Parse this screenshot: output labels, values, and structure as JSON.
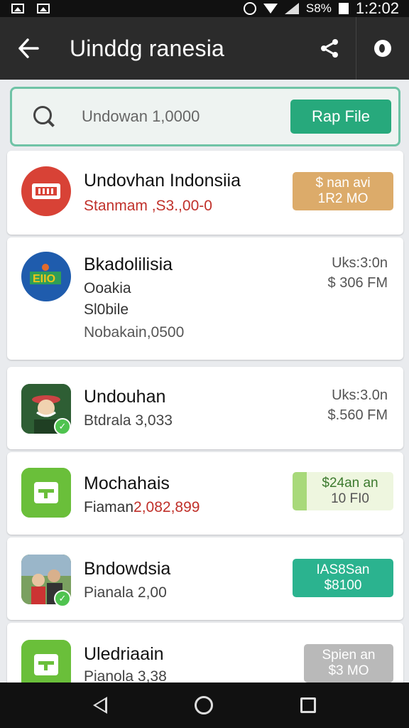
{
  "status_bar": {
    "battery_text": "S8%",
    "time": "1:2:02"
  },
  "toolbar": {
    "title": "Uinddg ranesia",
    "icons": [
      "back-arrow-icon",
      "share-icon",
      "more-icon"
    ]
  },
  "search": {
    "value": "Undowan 1,0000",
    "button_label": "Rap File"
  },
  "items": [
    {
      "title": "Undovhan Indonsiia",
      "subtitle_prefix": "Stanmam ",
      "subtitle_value": ",S3.,00-0",
      "badge_line1": "$ nan avi",
      "badge_line2": "1R2 MO",
      "badge_color": "#dcab6a"
    },
    {
      "title": "Bkadolilisia",
      "line2": "Ooakia",
      "line3": "Sl0bile",
      "line4": "Nobakain,0500",
      "meta1": "Uks:3:0n",
      "meta2": "$ 306 FM"
    },
    {
      "title": "Undouhan",
      "subtitle": "Btdrala 3,033",
      "meta1": "Uks:3.0n",
      "meta2": "$.560 FM"
    },
    {
      "title": "Mochahais",
      "subtitle_prefix": "Fiaman",
      "subtitle_value": "2,082,899",
      "badge_line1": "$24an an",
      "badge_line2": "10 FI0",
      "badge_color": "#eef6df"
    },
    {
      "title": "Bndowdsia",
      "subtitle": "Pianala 2,00",
      "badge_line1": "IAS8San",
      "badge_line2": "$8100",
      "badge_color": "#2bb38f"
    },
    {
      "title": "Uledriaain",
      "subtitle": "Pianola 3,38",
      "badge_line1": "Spien an",
      "badge_line2": "$3 MO",
      "badge_color": "#b9b9b9"
    }
  ],
  "colors": {
    "accent": "#27a97c",
    "toolbar": "#2b2b2b",
    "red_value": "#c0302a"
  }
}
